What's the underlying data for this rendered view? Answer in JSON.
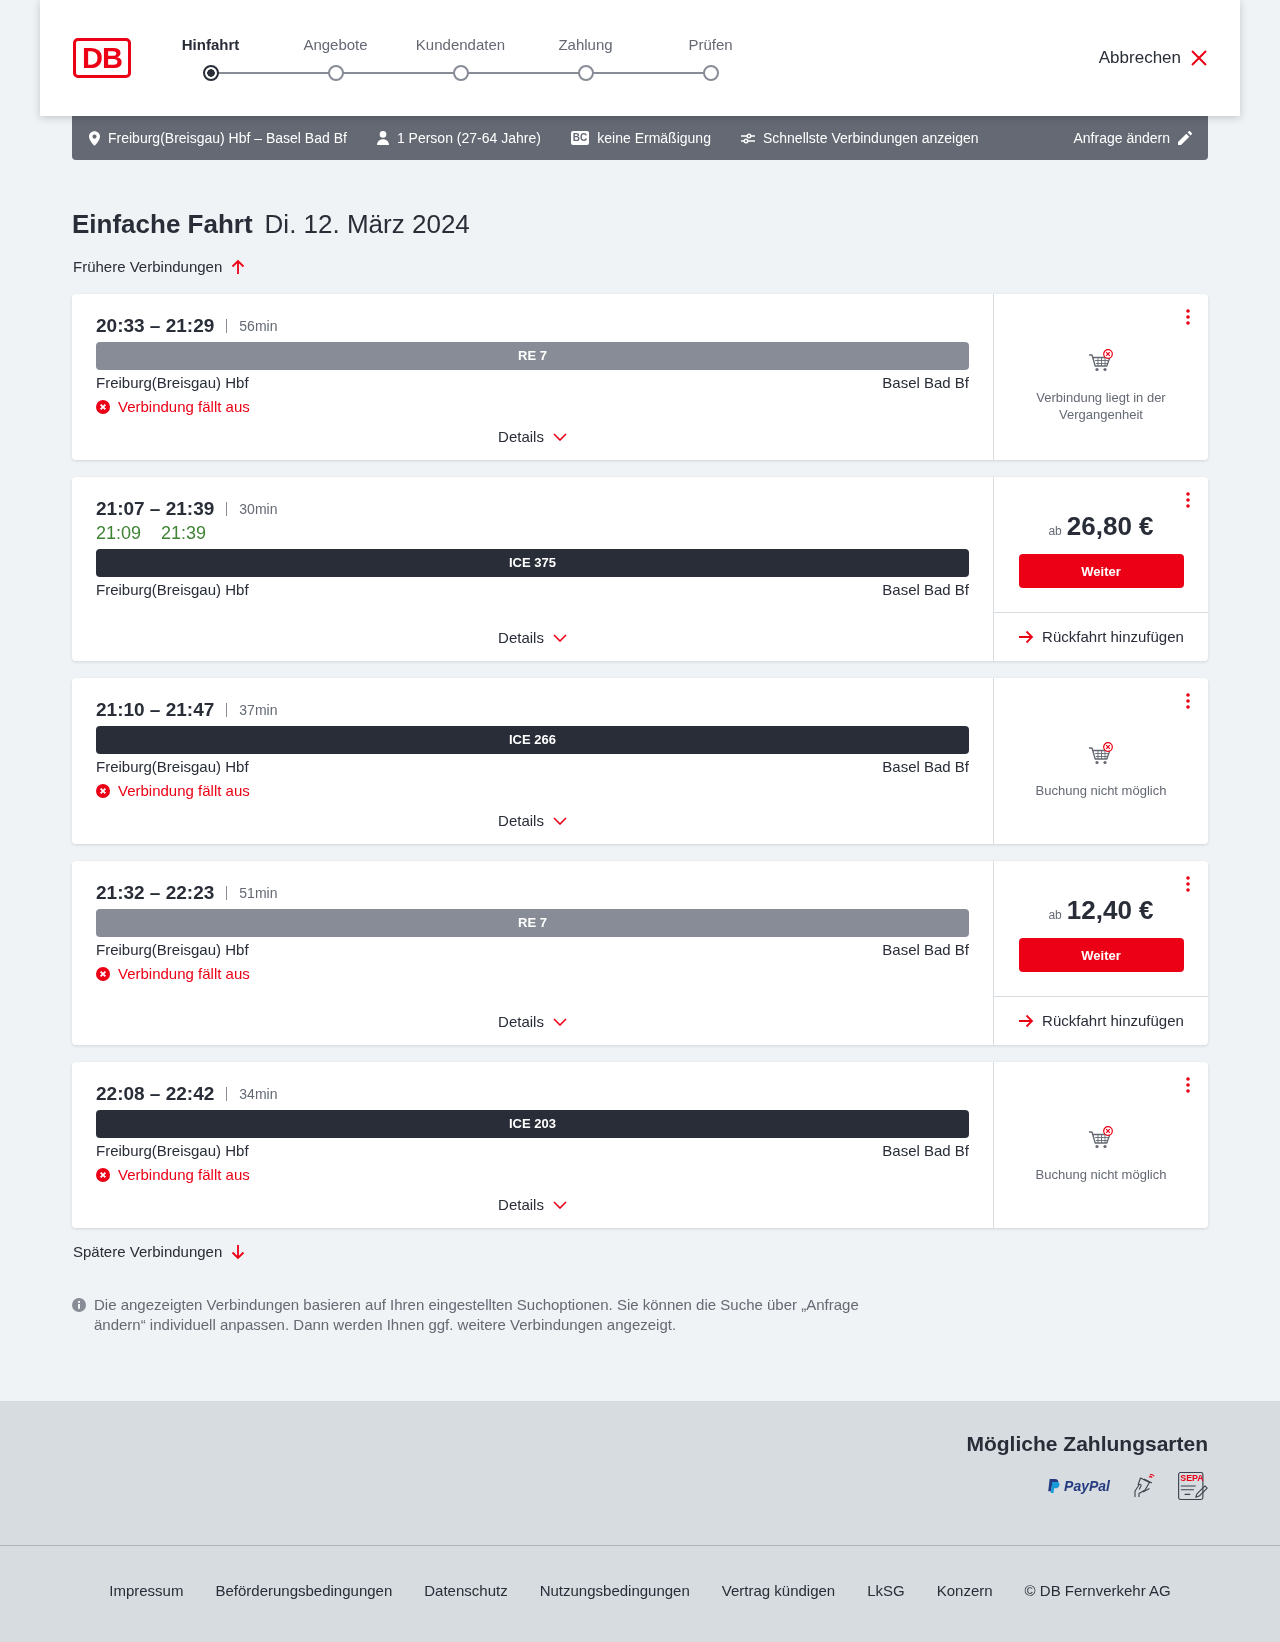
{
  "header": {
    "logo": "DB",
    "steps": [
      {
        "label": "Hinfahrt",
        "selected": true
      },
      {
        "label": "Angebote",
        "selected": false
      },
      {
        "label": "Kundendaten",
        "selected": false
      },
      {
        "label": "Zahlung",
        "selected": false
      },
      {
        "label": "Prüfen",
        "selected": false
      }
    ],
    "cancel": "Abbrechen"
  },
  "search_summary": {
    "items": [
      {
        "kind": "route",
        "text": "Freiburg(Breisgau) Hbf – Basel Bad Bf"
      },
      {
        "kind": "travellers",
        "text": "1 Person (27-64 Jahre)"
      },
      {
        "kind": "discount",
        "badge": "BC",
        "text": "keine Ermäßigung"
      },
      {
        "kind": "option",
        "text": "Schnellste Verbindungen anzeigen"
      }
    ],
    "edit": "Anfrage ändern"
  },
  "heading": {
    "title": "Einfache Fahrt",
    "date": "Di. 12. März 2024"
  },
  "earlier_link": "Frühere Verbindungen",
  "connections": [
    {
      "times": "20:33 – 21:29",
      "duration": "56min",
      "line": {
        "label": "RE 7",
        "kind": "regional"
      },
      "from": "Freiburg(Breisgau) Hbf",
      "to": "Basel Bad Bf",
      "notice": "Verbindung fällt aus",
      "details": "Details",
      "offer": {
        "kind": "unavailable",
        "text": "Verbindung liegt in der Vergangenheit"
      }
    },
    {
      "times": "21:07 – 21:39",
      "duration": "30min",
      "realtime": {
        "departure": "21:09",
        "arrival": "21:39"
      },
      "line": {
        "label": "ICE 375",
        "kind": "long_distance"
      },
      "from": "Freiburg(Breisgau) Hbf",
      "to": "Basel Bad Bf",
      "details": "Details",
      "offer": {
        "kind": "price",
        "prefix": "ab",
        "price": "26,80 €",
        "button": "Weiter",
        "return_link": "Rückfahrt hinzufügen"
      }
    },
    {
      "times": "21:10 – 21:47",
      "duration": "37min",
      "line": {
        "label": "ICE 266",
        "kind": "long_distance"
      },
      "from": "Freiburg(Breisgau) Hbf",
      "to": "Basel Bad Bf",
      "notice": "Verbindung fällt aus",
      "details": "Details",
      "offer": {
        "kind": "unavailable",
        "text": "Buchung nicht möglich"
      }
    },
    {
      "times": "21:32 – 22:23",
      "duration": "51min",
      "line": {
        "label": "RE 7",
        "kind": "regional"
      },
      "from": "Freiburg(Breisgau) Hbf",
      "to": "Basel Bad Bf",
      "notice": "Verbindung fällt aus",
      "details": "Details",
      "offer": {
        "kind": "price",
        "prefix": "ab",
        "price": "12,40 €",
        "button": "Weiter",
        "return_link": "Rückfahrt hinzufügen"
      }
    },
    {
      "times": "22:08 – 22:42",
      "duration": "34min",
      "line": {
        "label": "ICE 203",
        "kind": "long_distance"
      },
      "from": "Freiburg(Breisgau) Hbf",
      "to": "Basel Bad Bf",
      "notice": "Verbindung fällt aus",
      "details": "Details",
      "offer": {
        "kind": "unavailable",
        "text": "Buchung nicht möglich"
      }
    }
  ],
  "later_link": "Spätere Verbindungen",
  "info": "Die angezeigten Verbindungen basieren auf Ihren eingestellten Suchoptionen. Sie können die Suche über „Anfrage ändern“ individuell anpassen. Dann werden Ihnen ggf. weitere Verbindungen angezeigt.",
  "payment": {
    "title": "Mögliche Zahlungsarten",
    "methods": [
      {
        "kind": "paypal",
        "label": "PayPal"
      },
      {
        "kind": "contactless"
      },
      {
        "kind": "sepa",
        "label": "SEPA"
      }
    ]
  },
  "footer_links": [
    "Impressum",
    "Beförderungsbedingungen",
    "Datenschutz",
    "Nutzungsbedingungen",
    "Vertrag kündigen",
    "LkSG",
    "Konzern",
    "© DB Fernverkehr AG"
  ]
}
